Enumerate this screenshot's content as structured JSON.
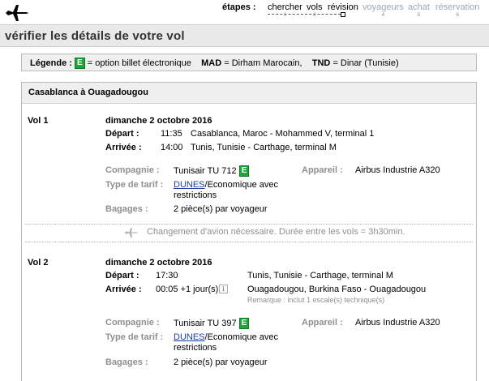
{
  "header": {
    "steps_label": "étapes :",
    "steps": [
      {
        "label": "chercher",
        "num": "1",
        "state": "done"
      },
      {
        "label": "vols",
        "num": "2",
        "state": "done"
      },
      {
        "label": "révision",
        "num": "3",
        "state": "current"
      },
      {
        "label": "voyageurs",
        "num": "4",
        "state": "todo"
      },
      {
        "label": "achat",
        "num": "5",
        "state": "todo"
      },
      {
        "label": "réservation",
        "num": "6",
        "state": "todo"
      }
    ]
  },
  "page_title": "vérifier les détails de votre vol",
  "legend": {
    "label": "Légende :",
    "e_badge": "E",
    "e_text": "= option billet électronique",
    "mad_code": "MAD",
    "mad_text": "= Dirham Marocain,",
    "tnd_code": "TND",
    "tnd_text": "= Dinar (Tunisie)"
  },
  "route": {
    "title": "Casablanca à Ouagadougou",
    "flights": [
      {
        "vol_label": "Vol 1",
        "date": "dimanche 2 octobre 2016",
        "depart_label": "Départ :",
        "depart_time": "11:35",
        "depart_place": "Casablanca, Maroc - Mohammed V, terminal 1",
        "arrivee_label": "Arrivée :",
        "arrivee_time": "14:00",
        "arrivee_place": "Tunis, Tunisie - Carthage, terminal M",
        "compagnie_label": "Compagnie :",
        "compagnie": "Tunisair TU 712",
        "appareil_label": "Appareil :",
        "appareil": "Airbus Industrie A320",
        "tarif_label": "Type de tarif :",
        "tarif_link": "DUNES",
        "tarif_rest_1": "/Economique avec",
        "tarif_rest_2": "restrictions",
        "bagages_label": "Bagages :",
        "bagages": "2 pièce(s) par voyageur"
      },
      {
        "vol_label": "Vol 2",
        "date": "dimanche 2 octobre 2016",
        "depart_label": "Départ :",
        "depart_time": "17:30",
        "depart_place": "Tunis, Tunisie - Carthage, terminal M",
        "arrivee_label": "Arrivée :",
        "arrivee_time": "00:05 +1 jour(s)",
        "arrivee_place": "Ouagadougou, Burkina Faso - Ouagadougou",
        "remark": "Remarque : inclut 1 escale(s) technique(s)",
        "compagnie_label": "Compagnie :",
        "compagnie": "Tunisair TU 397",
        "appareil_label": "Appareil :",
        "appareil": "Airbus Industrie A320",
        "tarif_label": "Type de tarif :",
        "tarif_link": "DUNES",
        "tarif_rest_1": "/Economique avec",
        "tarif_rest_2": "restrictions",
        "bagages_label": "Bagages :",
        "bagages": "2 pièce(s) par voyageur"
      }
    ],
    "change_notice": "Changement d'avion nécessaire. Durée entre les vols = 3h30min."
  },
  "colors": {
    "e_badge_green": "#1aa83a",
    "link_blue": "#1a3ea8",
    "muted_grey": "#8f8f8f",
    "panel_grey": "#efefef"
  },
  "icons": [
    "plane-logo-icon",
    "plane-change-icon",
    "info-icon"
  ]
}
